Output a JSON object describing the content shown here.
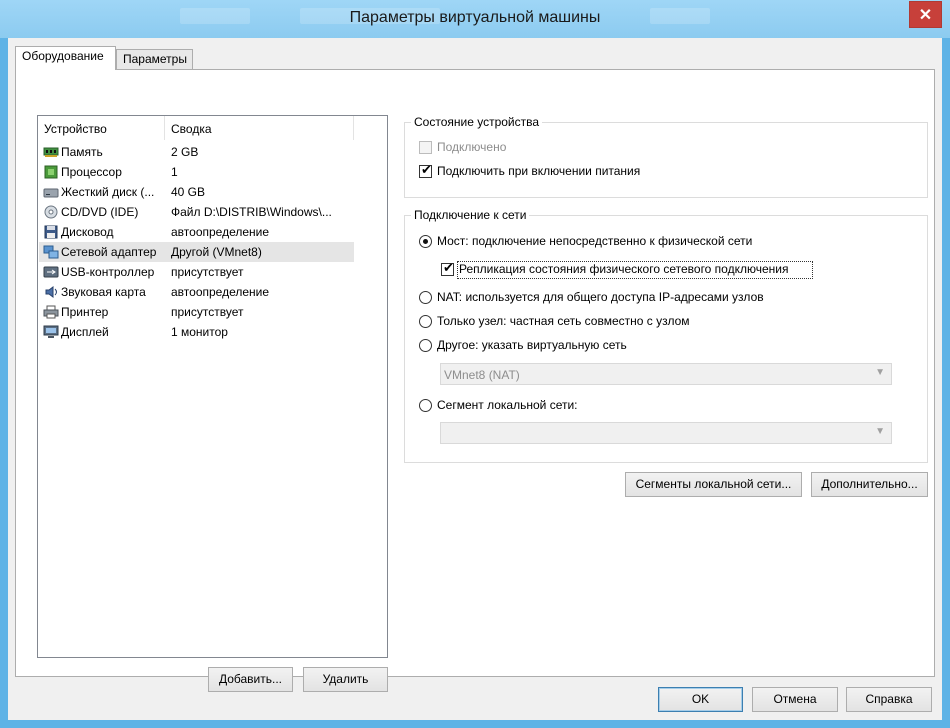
{
  "window": {
    "title": "Параметры виртуальной машины",
    "close_glyph": "✕"
  },
  "tabs": [
    {
      "label": "Оборудование"
    },
    {
      "label": "Параметры"
    }
  ],
  "device_list": {
    "columns": {
      "device": "Устройство",
      "summary": "Сводка"
    },
    "rows": [
      {
        "icon": "memory-icon",
        "device": "Память",
        "summary": "2 GB"
      },
      {
        "icon": "processor-icon",
        "device": "Процессор",
        "summary": "1"
      },
      {
        "icon": "hard-disk-icon",
        "device": "Жесткий диск (...",
        "summary": "40 GB"
      },
      {
        "icon": "cd-dvd-icon",
        "device": "CD/DVD (IDE)",
        "summary": "Файл D:\\DISTRIB\\Windows\\..."
      },
      {
        "icon": "floppy-icon",
        "device": "Дисковод",
        "summary": "автоопределение"
      },
      {
        "icon": "network-adapter-icon",
        "device": "Сетевой адаптер",
        "summary": "Другой (VMnet8)"
      },
      {
        "icon": "usb-icon",
        "device": "USB-контроллер",
        "summary": "присутствует"
      },
      {
        "icon": "sound-card-icon",
        "device": "Звуковая карта",
        "summary": "автоопределение"
      },
      {
        "icon": "printer-icon",
        "device": "Принтер",
        "summary": "присутствует"
      },
      {
        "icon": "display-icon",
        "device": "Дисплей",
        "summary": "1 монитор"
      }
    ],
    "selected_index": 5
  },
  "list_buttons": {
    "add": "Добавить...",
    "remove": "Удалить"
  },
  "device_status": {
    "title": "Состояние устройства",
    "connected": {
      "label": "Подключено",
      "checked": false,
      "enabled": false
    },
    "connect_at_power_on": {
      "label": "Подключить при включении питания",
      "checked": true
    }
  },
  "network": {
    "title": "Подключение к сети",
    "bridged": {
      "label": "Мост: подключение непосредственно к физической сети",
      "selected": true
    },
    "replicate": {
      "label": "Репликация состояния физического сетевого подключения",
      "checked": true
    },
    "nat": {
      "label": "NAT: используется для общего доступа IP-адресами узлов"
    },
    "host_only": {
      "label": "Только узел: частная сеть совместно с узлом"
    },
    "custom": {
      "label": "Другое: указать виртуальную сеть"
    },
    "custom_combo": {
      "value": "VMnet8 (NAT)"
    },
    "lan_segment": {
      "label": "Сегмент локальной сети:"
    },
    "lan_combo": {
      "value": ""
    }
  },
  "net_buttons": {
    "segments": "Сегменты локальной сети...",
    "advanced": "Дополнительно..."
  },
  "dialog_buttons": {
    "ok": "OK",
    "cancel": "Отмена",
    "help": "Справка"
  },
  "colors": {
    "titlebar": "#8ccbf0",
    "close": "#c7403a",
    "selection": "#e5e5e5",
    "default_button_border": "#3c7fb1"
  }
}
